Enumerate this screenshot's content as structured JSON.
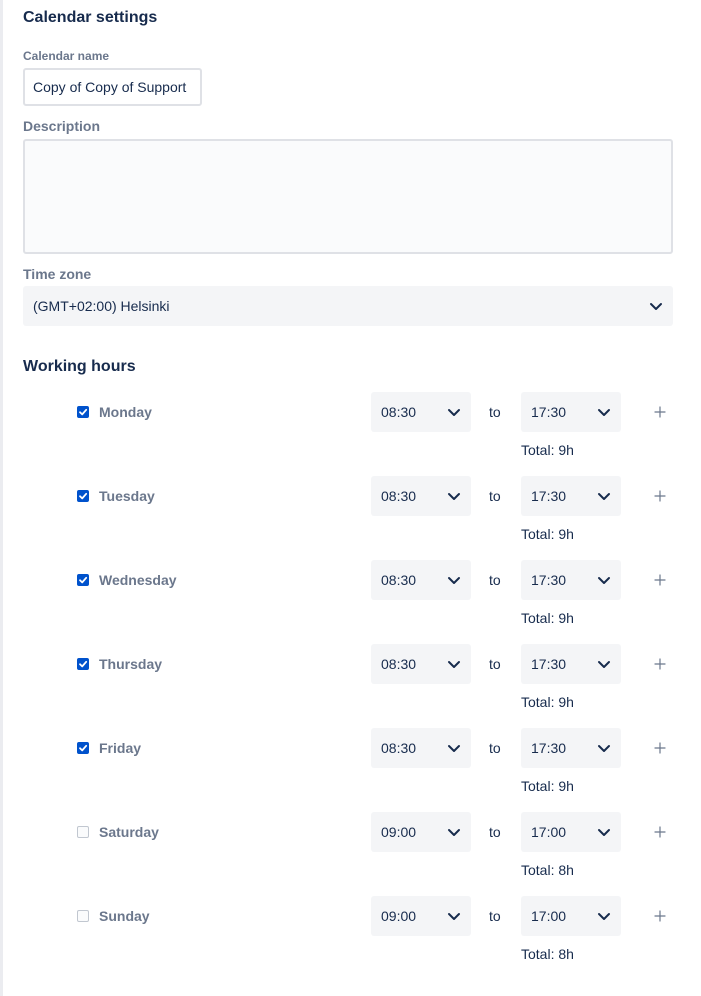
{
  "settings": {
    "title": "Calendar settings",
    "name_label": "Calendar name",
    "name_value": "Copy of Copy of Support",
    "description_label": "Description",
    "description_value": "",
    "timezone_label": "Time zone",
    "timezone_value": "(GMT+02:00) Helsinki"
  },
  "working_hours": {
    "title": "Working hours",
    "to_label": "to",
    "days": [
      {
        "name": "Monday",
        "checked": true,
        "from": "08:30",
        "to": "17:30",
        "total": "Total: 9h"
      },
      {
        "name": "Tuesday",
        "checked": true,
        "from": "08:30",
        "to": "17:30",
        "total": "Total: 9h"
      },
      {
        "name": "Wednesday",
        "checked": true,
        "from": "08:30",
        "to": "17:30",
        "total": "Total: 9h"
      },
      {
        "name": "Thursday",
        "checked": true,
        "from": "08:30",
        "to": "17:30",
        "total": "Total: 9h"
      },
      {
        "name": "Friday",
        "checked": true,
        "from": "08:30",
        "to": "17:30",
        "total": "Total: 9h"
      },
      {
        "name": "Saturday",
        "checked": false,
        "from": "09:00",
        "to": "17:00",
        "total": "Total: 8h"
      },
      {
        "name": "Sunday",
        "checked": false,
        "from": "09:00",
        "to": "17:00",
        "total": "Total: 8h"
      }
    ]
  },
  "icons": {
    "dropdown": "chevron-down-icon",
    "add": "plus-icon",
    "check": "checkmark-icon"
  },
  "colors": {
    "accent": "#0052cc",
    "text": "#172b4d",
    "subtle_text": "#6b778c",
    "field_bg": "#f4f5f7"
  }
}
